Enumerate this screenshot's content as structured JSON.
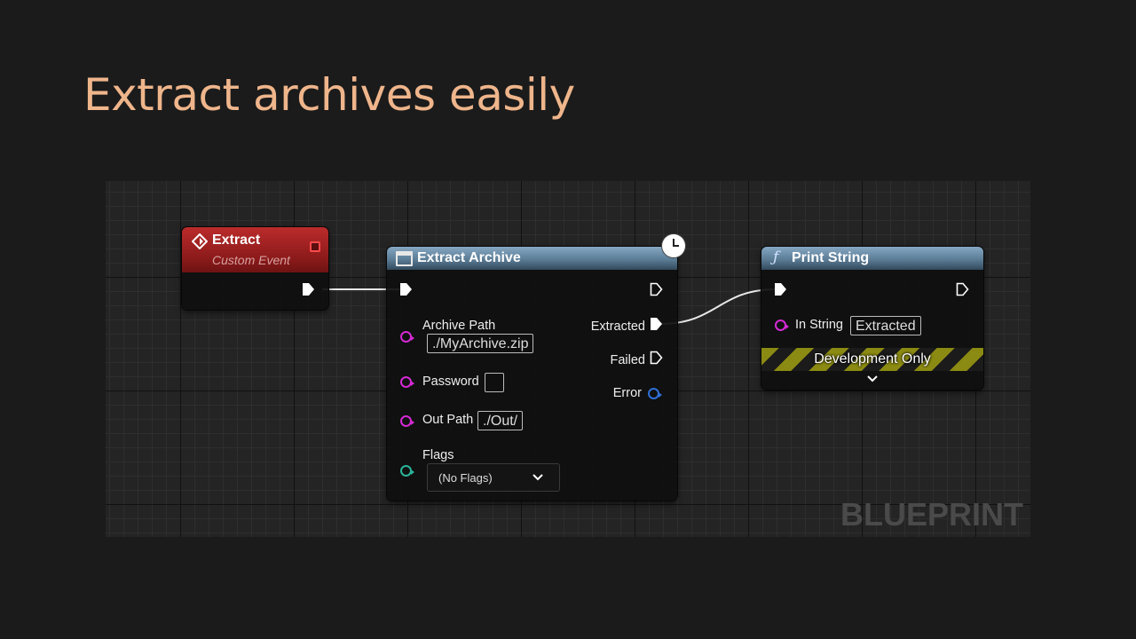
{
  "slide": {
    "title": "Extract archives easily"
  },
  "graph": {
    "watermark": "BLUEPRINT"
  },
  "event_node": {
    "title": "Extract",
    "subtitle": "Custom Event"
  },
  "extract_node": {
    "title": "Extract Archive",
    "inputs": {
      "archive_path": {
        "label": "Archive Path",
        "value": "./MyArchive.zip"
      },
      "password": {
        "label": "Password",
        "value": ""
      },
      "out_path": {
        "label": "Out Path",
        "value": "./Out/"
      },
      "flags": {
        "label": "Flags",
        "value": "(No Flags)"
      }
    },
    "outputs": {
      "extracted": "Extracted",
      "failed": "Failed",
      "error": "Error"
    }
  },
  "print_node": {
    "title": "Print String",
    "in_string": {
      "label": "In String",
      "value": "Extracted"
    },
    "dev_label": "Development Only"
  },
  "colors": {
    "title": "#efb58b",
    "event_header": "#8b1a1a",
    "function_header": "#5c7d96",
    "string_pin": "#d42ad4",
    "enum_pin": "#2bb39a",
    "error_pin": "#2f6fd6",
    "exec_pin": "#ffffff"
  },
  "icons": [
    "event-diamond-icon",
    "stop-square-icon",
    "clock-icon",
    "function-icon",
    "dropdown-chevron-icon",
    "expand-chevron-icon"
  ]
}
